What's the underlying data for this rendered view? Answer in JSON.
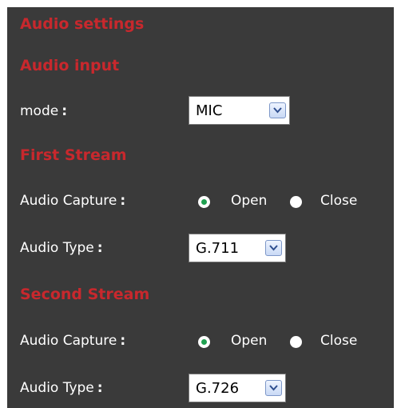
{
  "title": "Audio settings",
  "audio_input": {
    "heading": "Audio input",
    "mode_label": "mode",
    "colon": ":",
    "mode_value": "MIC"
  },
  "first_stream": {
    "heading": "First Stream",
    "capture_label": "Audio Capture",
    "open_label": "Open",
    "close_label": "Close",
    "capture_selected": "Open",
    "type_label": "Audio Type",
    "type_value": "G.711"
  },
  "second_stream": {
    "heading": "Second Stream",
    "capture_label": "Audio Capture",
    "open_label": "Open",
    "close_label": "Close",
    "capture_selected": "Open",
    "type_label": "Audio Type",
    "type_value": "G.726"
  },
  "icons": {
    "dropdown": "chevron-down-icon"
  },
  "colors": {
    "background": "#3a3a3a",
    "heading": "#c8282d",
    "radio_selected": "#1fa050"
  }
}
